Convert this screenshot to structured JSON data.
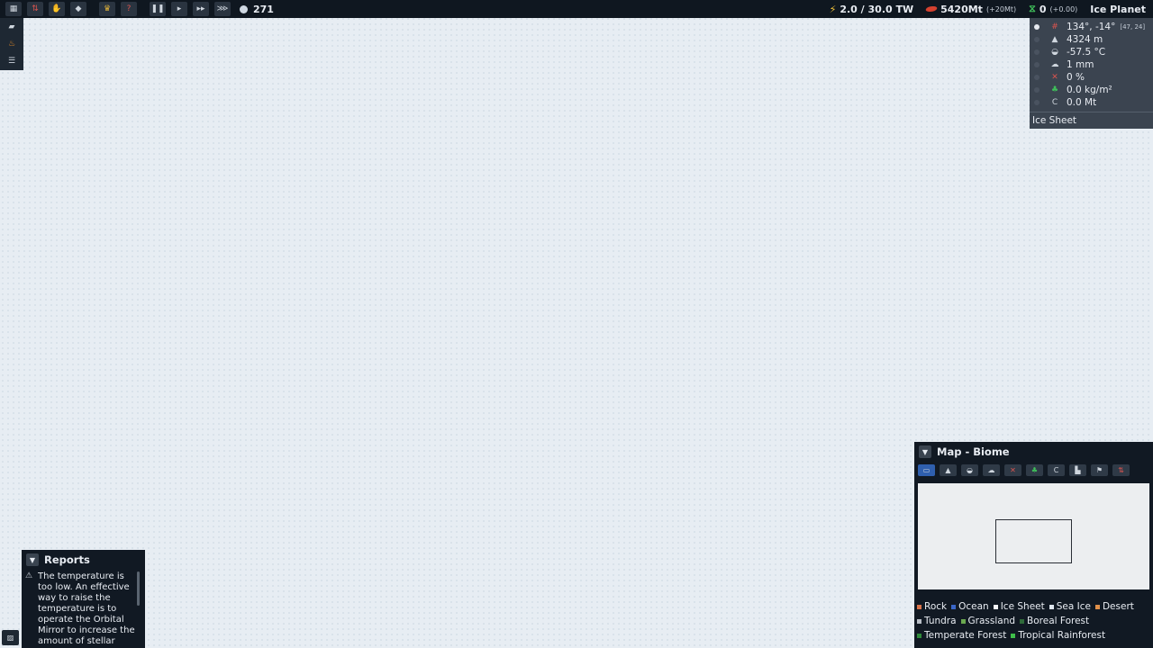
{
  "topbar": {
    "days": "271",
    "energy": "2.0 / 30.0 TW",
    "rock": "5420Mt",
    "rock_delta": "(+20Mt)",
    "biomass": "0",
    "biomass_delta": "(+0.00)",
    "planet_name": "Ice Planet",
    "left_buttons": [
      "menu-icon",
      "exploration-icon",
      "hand-icon",
      "research-icon",
      "trophy-icon",
      "help-icon"
    ],
    "speed_buttons": [
      "pause-icon",
      "play-icon",
      "fast-forward-icon",
      "fastest-icon"
    ]
  },
  "left_tools": [
    "build-icon",
    "flame-icon",
    "sliders-icon"
  ],
  "info_panel": {
    "coords": "134°, -14°",
    "grid": "[47, 24]",
    "elevation": "4324 m",
    "temperature": "-57.5 °C",
    "rainfall": "1 mm",
    "humidity": "0 %",
    "vegetation": "0.0 kg/m²",
    "carbon": "0.0 Mt",
    "carbon_icon_text": "C",
    "biome": "Ice Sheet"
  },
  "map_panel": {
    "title": "Map - Biome",
    "carbon_tab_text": "C",
    "legend": [
      {
        "label": "Rock",
        "color": "#d9734a"
      },
      {
        "label": "Ocean",
        "color": "#3a66c8"
      },
      {
        "label": "Ice Sheet",
        "color": "#f4f6f8"
      },
      {
        "label": "Sea Ice",
        "color": "#dfe6ee"
      },
      {
        "label": "Desert",
        "color": "#e0904a"
      },
      {
        "label": "Tundra",
        "color": "#b8bec6"
      },
      {
        "label": "Grassland",
        "color": "#6aa84f"
      },
      {
        "label": "Boreal Forest",
        "color": "#2f6a3a"
      },
      {
        "label": "Temperate Forest",
        "color": "#2f8a3a"
      },
      {
        "label": "Tropical Rainforest",
        "color": "#3fbf4a"
      }
    ]
  },
  "reports": {
    "title": "Reports",
    "message": "The temperature is too low. An effective way to raise the temperature is to operate the Orbital Mirror to increase the amount of stellar"
  }
}
